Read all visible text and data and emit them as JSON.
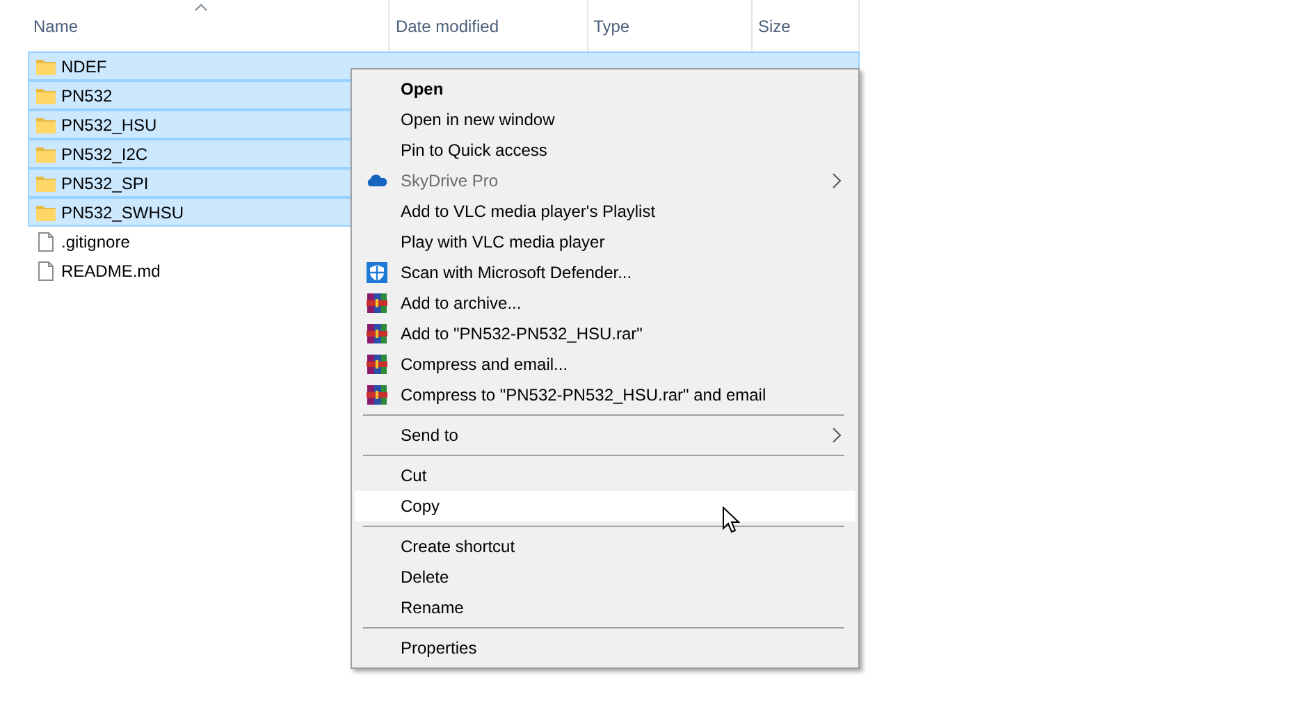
{
  "columns": [
    {
      "label": "Name",
      "sorted": true
    },
    {
      "label": "Date modified",
      "sorted": false
    },
    {
      "label": "Type",
      "sorted": false
    },
    {
      "label": "Size",
      "sorted": false
    }
  ],
  "files": [
    {
      "name": "NDEF",
      "kind": "folder",
      "selected": true
    },
    {
      "name": "PN532",
      "kind": "folder",
      "selected": true
    },
    {
      "name": "PN532_HSU",
      "kind": "folder",
      "selected": true
    },
    {
      "name": "PN532_I2C",
      "kind": "folder",
      "selected": true
    },
    {
      "name": "PN532_SPI",
      "kind": "folder",
      "selected": true
    },
    {
      "name": "PN532_SWHSU",
      "kind": "folder",
      "selected": true
    },
    {
      "name": ".gitignore",
      "kind": "file",
      "selected": false
    },
    {
      "name": "README.md",
      "kind": "file",
      "selected": false
    }
  ],
  "context_menu": [
    {
      "kind": "item",
      "label": "Open",
      "bold": true
    },
    {
      "kind": "item",
      "label": "Open in new window"
    },
    {
      "kind": "item",
      "label": "Pin to Quick access"
    },
    {
      "kind": "cloud",
      "label": "SkyDrive Pro",
      "disabled": true,
      "submenu": true
    },
    {
      "kind": "item",
      "label": "Add to VLC media player's Playlist"
    },
    {
      "kind": "item",
      "label": "Play with VLC media player"
    },
    {
      "kind": "shield",
      "label": "Scan with Microsoft Defender..."
    },
    {
      "kind": "archive",
      "label": "Add to archive..."
    },
    {
      "kind": "archive",
      "label": "Add to \"PN532-PN532_HSU.rar\""
    },
    {
      "kind": "archive",
      "label": "Compress and email..."
    },
    {
      "kind": "archive",
      "label": "Compress to \"PN532-PN532_HSU.rar\" and email"
    },
    {
      "kind": "separator"
    },
    {
      "kind": "item",
      "label": "Send to",
      "submenu": true
    },
    {
      "kind": "separator"
    },
    {
      "kind": "item",
      "label": "Cut"
    },
    {
      "kind": "item",
      "label": "Copy",
      "hovered": true
    },
    {
      "kind": "separator"
    },
    {
      "kind": "item",
      "label": "Create shortcut"
    },
    {
      "kind": "item",
      "label": "Delete"
    },
    {
      "kind": "item",
      "label": "Rename"
    },
    {
      "kind": "separator"
    },
    {
      "kind": "item",
      "label": "Properties"
    }
  ]
}
